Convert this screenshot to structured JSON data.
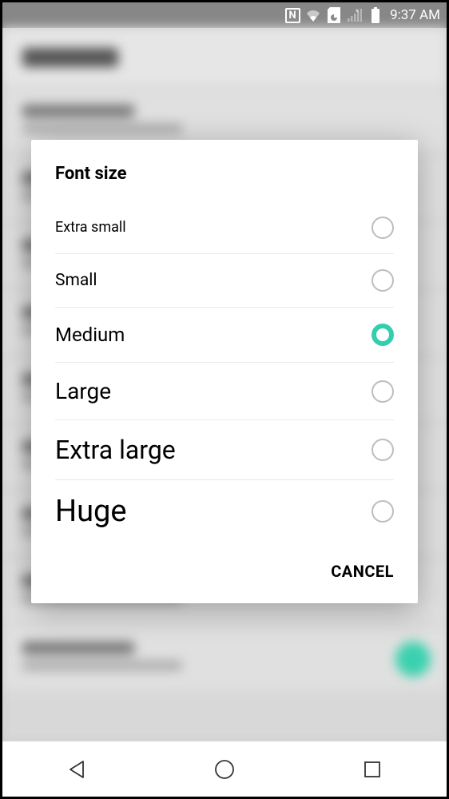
{
  "statusBar": {
    "time": "9:37 AM"
  },
  "dialog": {
    "title": "Font size",
    "options": [
      {
        "label": "Extra small",
        "selected": false
      },
      {
        "label": "Small",
        "selected": false
      },
      {
        "label": "Medium",
        "selected": true
      },
      {
        "label": "Large",
        "selected": false
      },
      {
        "label": "Extra large",
        "selected": false
      },
      {
        "label": "Huge",
        "selected": false
      }
    ],
    "cancel": "CANCEL"
  }
}
